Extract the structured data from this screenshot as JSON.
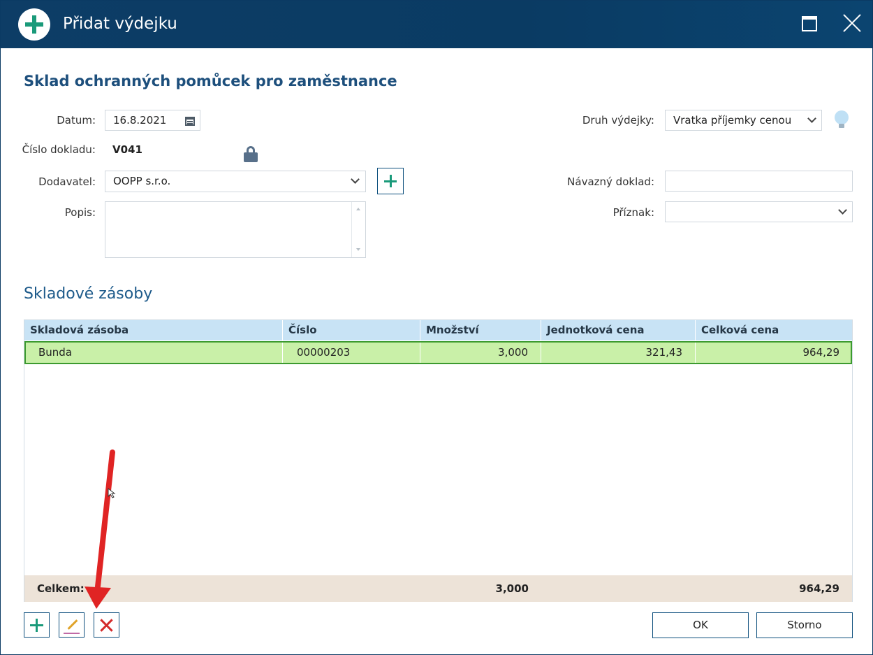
{
  "window": {
    "title": "Přidat výdejku"
  },
  "form": {
    "heading": "Sklad ochranných pomůcek pro zaměstnance",
    "datum_label": "Datum:",
    "datum_value": "16.8.2021",
    "cislo_label": "Číslo dokladu:",
    "cislo_value": "V041",
    "dodavatel_label": "Dodavatel:",
    "dodavatel_value": "OOPP s.r.o.",
    "popis_label": "Popis:",
    "popis_value": "",
    "druh_label": "Druh výdejky:",
    "druh_value": "Vratka příjemky cenou",
    "navazny_label": "Návazný doklad:",
    "navazny_value": "",
    "priznak_label": "Příznak:",
    "priznak_value": ""
  },
  "stock": {
    "heading": "Skladové zásoby",
    "columns": [
      "Skladová zásoba",
      "Číslo",
      "Množství",
      "Jednotková cena",
      "Celková cena"
    ],
    "rows": [
      {
        "name": "Bunda",
        "number": "00000203",
        "quantity": "3,000",
        "unit_price": "321,43",
        "total_price": "964,29"
      }
    ],
    "footer": {
      "label": "Celkem:",
      "quantity": "3,000",
      "total": "964,29"
    }
  },
  "buttons": {
    "ok": "OK",
    "cancel": "Storno"
  },
  "icons": {
    "title": "plus-circle-icon",
    "date": "calendar-icon",
    "lock": "lock-icon",
    "hint": "lightbulb-icon",
    "add": "plus-icon",
    "edit": "pencil-icon",
    "delete": "x-icon"
  },
  "colors": {
    "titlebar": "#0b3a63",
    "accent": "#1a9a7a",
    "selected_row": "#c9f0a8",
    "selected_border": "#3c9a2f",
    "grid_header": "#c8e3f5",
    "grid_footer": "#ede3d8",
    "annotation_arrow": "#e02424"
  }
}
